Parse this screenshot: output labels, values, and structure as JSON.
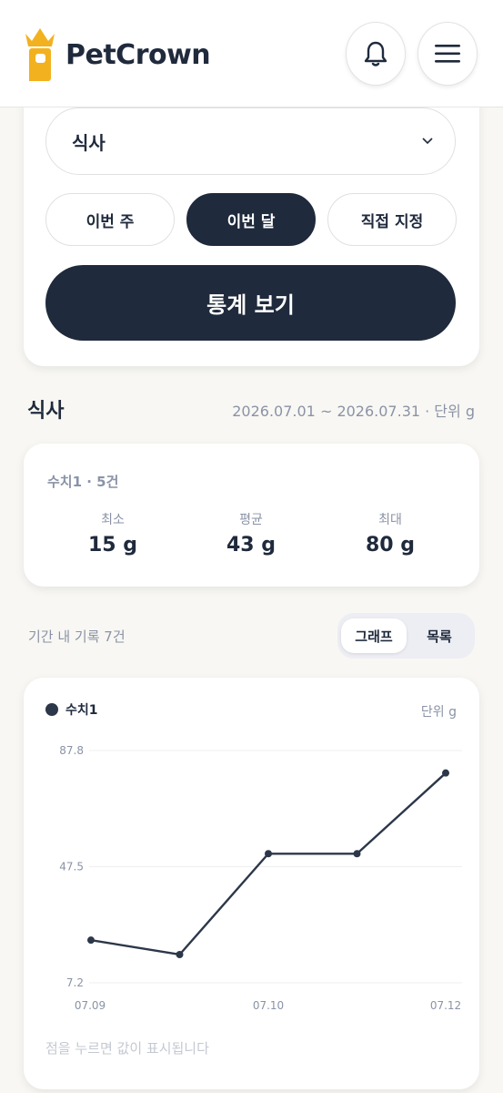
{
  "colors": {
    "primary": "#1f2a3c",
    "muted": "#8a93a6",
    "crown_gold": "#f2b11f",
    "background": "#f8f7f3"
  },
  "header": {
    "app_name": "PetCrown",
    "logo_icon": "crown-p-logo-icon",
    "bell_icon": "bell-icon",
    "menu_icon": "hamburger-menu-icon"
  },
  "filter": {
    "selected_category": "식사",
    "periods": [
      {
        "label": "이번 주",
        "active": false
      },
      {
        "label": "이번 달",
        "active": true
      },
      {
        "label": "직접 지정",
        "active": false
      }
    ],
    "submit_label": "통계 보기"
  },
  "section": {
    "title": "식사",
    "range": "2026.07.01 ~ 2026.07.31 · 단위 g"
  },
  "summary": {
    "heading": "수치1 · 5건",
    "min_label": "최소",
    "min_value": "15 g",
    "avg_label": "평균",
    "avg_value": "43 g",
    "max_label": "최대",
    "max_value": "80 g"
  },
  "records": {
    "count_text": "기간 내 기록 7건",
    "toggle_graph": "그래프",
    "toggle_list": "목록"
  },
  "chart": {
    "legend_label": "수치1",
    "unit_label": "단위 g",
    "hint": "점을 누르면 값이 표시됩니다"
  },
  "chart_data": {
    "type": "line",
    "series": [
      {
        "name": "수치1",
        "values": [
          22,
          17,
          52,
          52,
          80
        ]
      }
    ],
    "y_ticks": [
      "87.8",
      "47.5",
      "7.2"
    ],
    "x_ticks": [
      "07.09",
      "07.10",
      "07.12"
    ],
    "ylim": [
      7.2,
      87.8
    ]
  }
}
